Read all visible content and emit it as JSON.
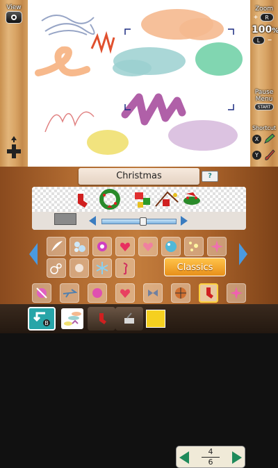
{
  "top": {
    "view_label": "View",
    "zoom_label": "Zoom",
    "zoom_value": "100",
    "zoom_unit": "%",
    "r_label": "R",
    "l_label": "L",
    "pause_label": "Pause",
    "menu_label": "Menu",
    "start_label": "START",
    "shortcut_label": "Shortcut",
    "x_label": "X",
    "y_label": "Y"
  },
  "bottom": {
    "category_title": "Christmas",
    "help_label": "?",
    "classics_label": "Classics",
    "b_label": "B",
    "page_current": "4",
    "page_total": "6"
  },
  "colors": {
    "accent_orange": "#f0a030",
    "selected_color": "#f5d020"
  },
  "stamps_preview": [
    "christmas-stocking-icon",
    "christmas-wreath-icon",
    "gift-boxes-icon",
    "xmas-decorations-icon",
    "holly-icon"
  ],
  "stamp_tiles_row1": [
    "feather-icon",
    "bubbles-icon",
    "sparkle-star-icon",
    "ribbon-heart-icon",
    "lace-heart-icon",
    "glass-orb-icon",
    "sparkle-dots-icon",
    "pink-star-icon"
  ],
  "stamp_tiles_row2": [
    "circles-icon",
    "music-note-fx-icon",
    "snowflake-icon",
    "music-note-icon"
  ],
  "recent_stamps": [
    "candy-icon",
    "airplane-icon",
    "pink-gem-icon",
    "heart-icon",
    "ribbon-icon",
    "pinwheel-icon",
    "basketball-icon",
    "stocking-icon",
    "pink-sparkle-icon"
  ]
}
